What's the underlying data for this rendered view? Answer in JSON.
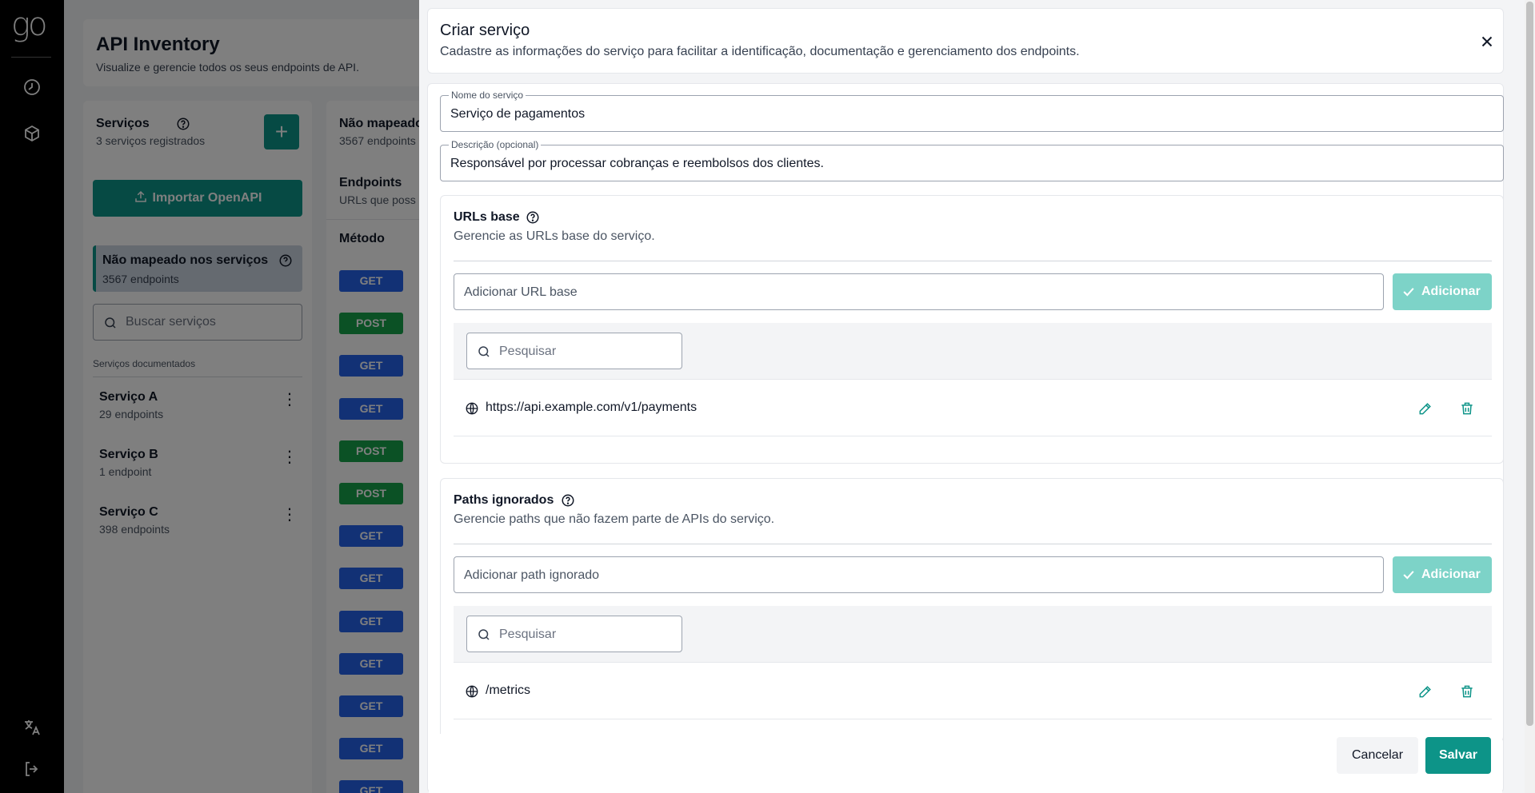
{
  "sidebar": {
    "logo": "go",
    "icons": [
      "dashboard-icon",
      "box-icon",
      "translate-icon",
      "logout-icon"
    ]
  },
  "background": {
    "header": {
      "title": "API Inventory",
      "subtitle": "Visualize e gerencie todos os seus endpoints de API."
    },
    "services": {
      "title": "Serviços",
      "count": "3 serviços registrados",
      "import_label": "Importar OpenAPI",
      "unmapped": {
        "title": "Não mapeado nos serviços",
        "count": "3567 endpoints"
      },
      "search_placeholder": "Buscar serviços",
      "documented_label": "Serviços documentados",
      "items": [
        {
          "name": "Serviço A",
          "count": "29 endpoints"
        },
        {
          "name": "Serviço B",
          "count": "1 endpoint"
        },
        {
          "name": "Serviço C",
          "count": "398 endpoints"
        }
      ]
    },
    "endpoints": {
      "title": "Não mapeado",
      "count": "3567 endpoints",
      "section_title": "Endpoints",
      "section_desc": "URLs que poss",
      "column_method": "Método",
      "methods": [
        "GET",
        "POST",
        "GET",
        "GET",
        "POST",
        "POST",
        "GET",
        "GET",
        "GET",
        "GET",
        "GET",
        "GET",
        "GET"
      ]
    }
  },
  "modal": {
    "title": "Criar serviço",
    "description": "Cadastre as informações do serviço para facilitar a identificação, documentação e gerenciamento dos endpoints.",
    "name_field": {
      "label": "Nome do serviço",
      "value": "Serviço de pagamentos"
    },
    "desc_field": {
      "label": "Descrição (opcional)",
      "value": "Responsável por processar cobranças e reembolsos dos clientes."
    },
    "base_urls": {
      "title": "URLs base",
      "description": "Gerencie as URLs base do serviço.",
      "input_placeholder": "Adicionar URL base",
      "add_label": "Adicionar",
      "search_placeholder": "Pesquisar",
      "items": [
        "https://api.example.com/v1/payments"
      ]
    },
    "ignored_paths": {
      "title": "Paths ignorados",
      "description": "Gerencie paths que não fazem parte de APIs do serviço.",
      "input_placeholder": "Adicionar path ignorado",
      "add_label": "Adicionar",
      "search_placeholder": "Pesquisar",
      "items": [
        "/metrics"
      ]
    },
    "cancel_label": "Cancelar",
    "save_label": "Salvar"
  },
  "colors": {
    "primary": "#0d9488",
    "primary_disabled": "#7dd3c8",
    "get": "#2563eb",
    "post": "#16a34a",
    "rail": "#000000"
  }
}
